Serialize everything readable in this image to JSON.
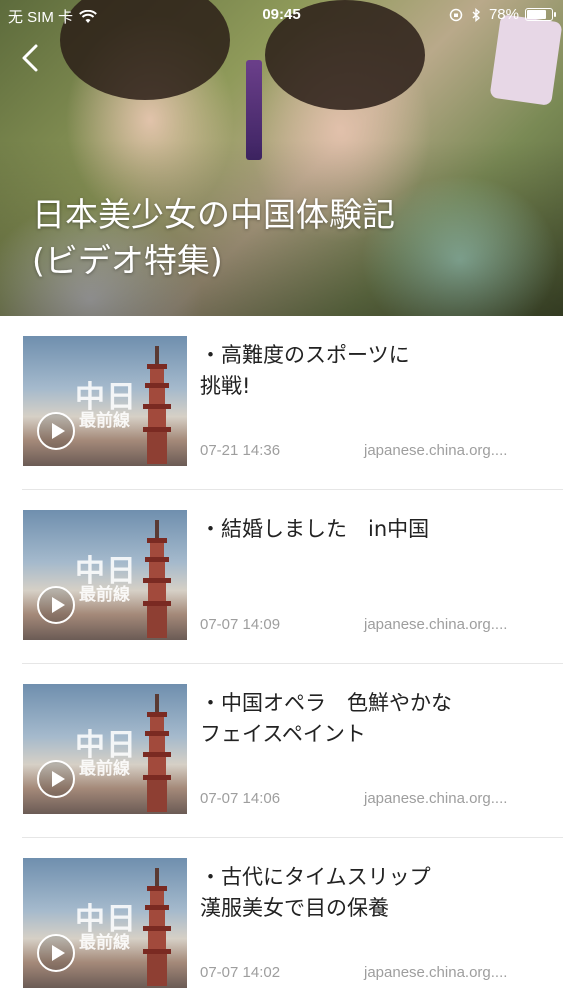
{
  "status_bar": {
    "carrier": "无 SIM 卡",
    "time": "09:45",
    "battery": "78%"
  },
  "hero": {
    "title": "日本美少女の中国体験記\n(ビデオ特集)"
  },
  "thumbnail": {
    "logo_main": "中日",
    "logo_sub": "最前線"
  },
  "items": [
    {
      "title": "・高難度のスポーツに\n挑戦!",
      "time": "07-21 14:36",
      "source": "japanese.china.org...."
    },
    {
      "title": "・結婚しました　in中国",
      "time": "07-07 14:09",
      "source": "japanese.china.org...."
    },
    {
      "title": "・中国オペラ　色鮮やかな\nフェイスペイント",
      "time": "07-07 14:06",
      "source": "japanese.china.org...."
    },
    {
      "title": "・古代にタイムスリップ\n漢服美女で目の保養",
      "time": "07-07 14:02",
      "source": "japanese.china.org...."
    }
  ]
}
